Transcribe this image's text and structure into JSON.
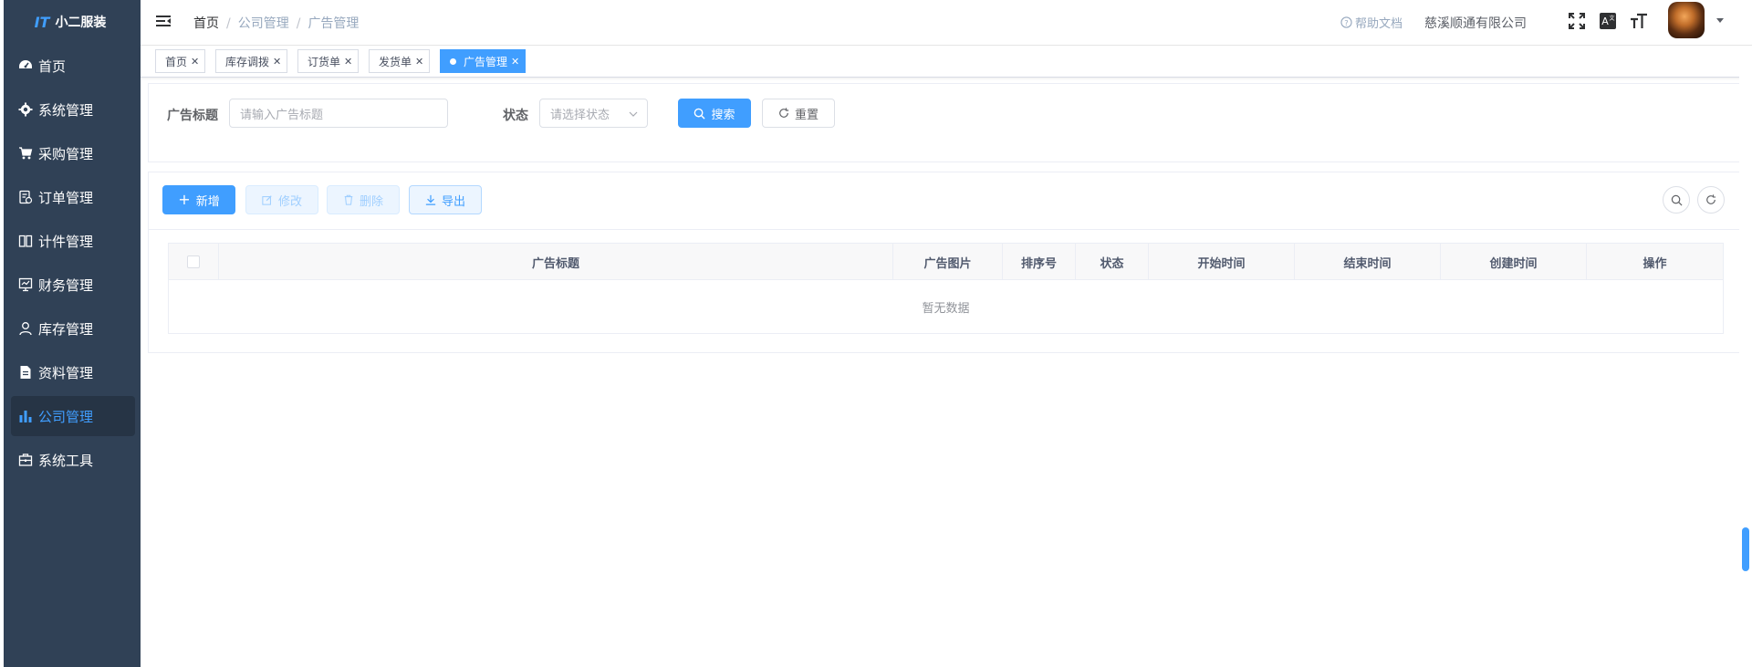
{
  "app": {
    "logo_text": "小二服装",
    "logo_mark": "IT"
  },
  "sidebar": {
    "items": [
      {
        "label": "首页",
        "icon": "dashboard-icon"
      },
      {
        "label": "系统管理",
        "icon": "gear-icon"
      },
      {
        "label": "采购管理",
        "icon": "cart-icon"
      },
      {
        "label": "订单管理",
        "icon": "order-icon"
      },
      {
        "label": "计件管理",
        "icon": "book-icon"
      },
      {
        "label": "财务管理",
        "icon": "monitor-icon"
      },
      {
        "label": "库存管理",
        "icon": "user-icon"
      },
      {
        "label": "资料管理",
        "icon": "document-icon"
      },
      {
        "label": "公司管理",
        "icon": "chart-icon",
        "active": true
      },
      {
        "label": "系统工具",
        "icon": "toolbox-icon"
      }
    ]
  },
  "header": {
    "breadcrumb": [
      "首页",
      "公司管理",
      "广告管理"
    ],
    "help_label": "帮助文档",
    "company_name": "慈溪顺通有限公司"
  },
  "tags": [
    {
      "label": "首页"
    },
    {
      "label": "库存调拨"
    },
    {
      "label": "订货单"
    },
    {
      "label": "发货单"
    },
    {
      "label": "广告管理",
      "active": true
    }
  ],
  "search": {
    "title_label": "广告标题",
    "title_placeholder": "请输入广告标题",
    "status_label": "状态",
    "status_placeholder": "请选择状态",
    "search_button": "搜索",
    "reset_button": "重置"
  },
  "toolbar": {
    "add": "新增",
    "edit": "修改",
    "delete": "删除",
    "export": "导出"
  },
  "table": {
    "columns": [
      "广告标题",
      "广告图片",
      "排序号",
      "状态",
      "开始时间",
      "结束时间",
      "创建时间",
      "操作"
    ],
    "empty_text": "暂无数据"
  },
  "colors": {
    "primary": "#409eff",
    "sidebar_bg": "#304156"
  }
}
